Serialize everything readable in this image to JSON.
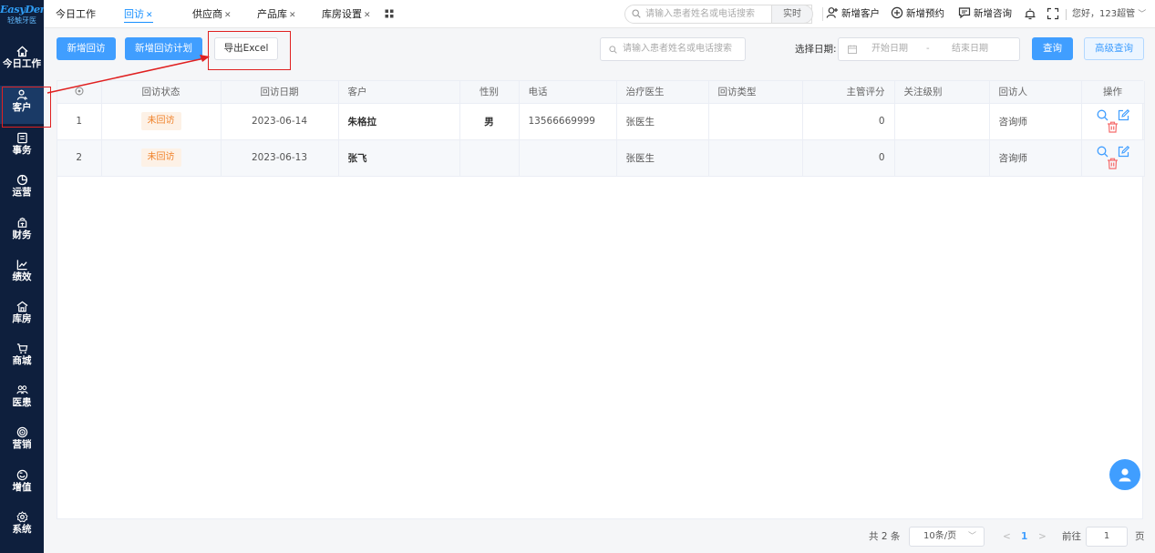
{
  "brand": {
    "name": "EasyDent",
    "sub": "轻触牙医"
  },
  "sidebar": {
    "items": [
      {
        "label": "今日工作",
        "icon": "home-icon"
      },
      {
        "label": "客户",
        "icon": "user-icon"
      },
      {
        "label": "事务",
        "icon": "document-icon"
      },
      {
        "label": "运营",
        "icon": "pie-chart-icon"
      },
      {
        "label": "财务",
        "icon": "finance-icon"
      },
      {
        "label": "绩效",
        "icon": "line-chart-icon"
      },
      {
        "label": "库房",
        "icon": "warehouse-icon"
      },
      {
        "label": "商城",
        "icon": "cart-icon"
      },
      {
        "label": "医患",
        "icon": "doctor-patient-icon"
      },
      {
        "label": "营销",
        "icon": "marketing-icon"
      },
      {
        "label": "增值",
        "icon": "value-added-icon"
      },
      {
        "label": "系统",
        "icon": "settings-icon"
      }
    ]
  },
  "tabs": [
    {
      "label": "今日工作",
      "closable": false
    },
    {
      "label": "回访",
      "closable": true,
      "active": true
    },
    {
      "label": "供应商",
      "closable": true
    },
    {
      "label": "产品库",
      "closable": true
    },
    {
      "label": "库房设置",
      "closable": true
    }
  ],
  "topbar": {
    "search_placeholder": "请输入患者姓名或电话搜索",
    "realtime": "实时",
    "new_customer": "新增客户",
    "new_appointment": "新增预约",
    "new_consult": "新增咨询",
    "user": "您好，123超管"
  },
  "toolbar": {
    "new_visit": "新增回访",
    "new_plan": "新增回访计划",
    "export": "导出Excel",
    "search_placeholder": "请输入患者姓名或电话搜索",
    "date_label": "选择日期:",
    "start_date": "开始日期",
    "date_sep": "-",
    "end_date": "结束日期",
    "query": "查询",
    "advanced": "高级查询"
  },
  "table": {
    "headers": [
      "",
      "回访状态",
      "回访日期",
      "客户",
      "性别",
      "电话",
      "治疗医生",
      "回访类型",
      "主管评分",
      "关注级别",
      "回访人",
      "操作"
    ],
    "rows": [
      {
        "index": "1",
        "status": "未回访",
        "date": "2023-06-14",
        "customer": "朱格拉",
        "gender": "男",
        "phone": "13566669999",
        "doctor": "张医生",
        "type": "",
        "score": "0",
        "level": "",
        "visitor": "咨询师"
      },
      {
        "index": "2",
        "status": "未回访",
        "date": "2023-06-13",
        "customer": "张飞",
        "gender": "",
        "phone": "",
        "doctor": "张医生",
        "type": "",
        "score": "0",
        "level": "",
        "visitor": "咨询师"
      }
    ]
  },
  "pagination": {
    "total": "共 2 条",
    "page_size": "10条/页",
    "prev": "<",
    "current": "1",
    "next": ">",
    "goto_prefix": "前往",
    "goto_value": "1",
    "goto_suffix": "页"
  },
  "colors": {
    "primary": "#409eff",
    "sidebar": "#0e1f3d",
    "highlight": "#e02020",
    "status": "#f0822a"
  }
}
